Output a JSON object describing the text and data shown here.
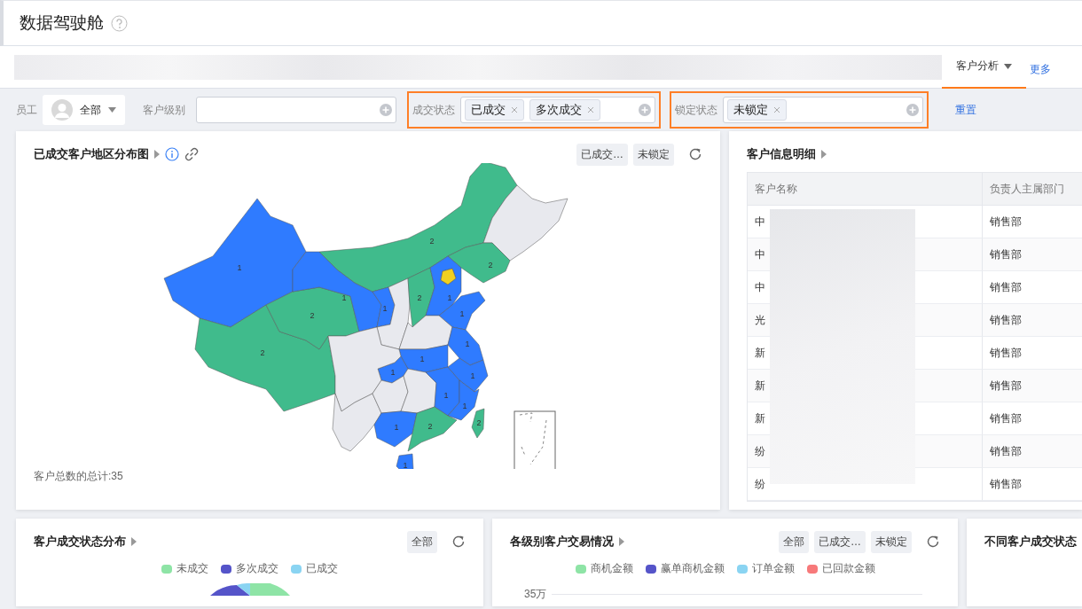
{
  "header": {
    "title": "数据驾驶舱"
  },
  "nav": {
    "tabs": [
      {
        "label": "客户分析",
        "selected": true
      }
    ],
    "more_link": "更多"
  },
  "filters": {
    "employee": {
      "label": "员工",
      "value": "全部"
    },
    "customer_level": {
      "label": "客户级别"
    },
    "deal_status": {
      "label": "成交状态",
      "highlighted": true,
      "tags": [
        "已成交",
        "多次成交"
      ]
    },
    "lock_status": {
      "label": "锁定状态",
      "highlighted": true,
      "tags": [
        "未锁定"
      ]
    },
    "reset": "重置"
  },
  "map_card": {
    "title": "已成交客户地区分布图",
    "chips": [
      "已成交…",
      "未锁定"
    ],
    "regions": [
      {
        "label": "1",
        "color": "#2f7bff"
      },
      {
        "label": "2",
        "color": "#40bb8c"
      },
      {
        "label": "2",
        "color": "#40bb8c"
      },
      {
        "label": "1",
        "color": "#2f7bff"
      },
      {
        "label": "2",
        "color": "#40bb8c"
      },
      {
        "color": "#e8e9ee"
      },
      {
        "label": "2",
        "color": "#40bb8c"
      },
      {
        "label": "1",
        "color": "#2f7bff"
      },
      {
        "color": "#e8e9ee"
      },
      {
        "label": "2",
        "color": "#40bb8c"
      },
      {
        "label": "1",
        "color": "#2f7bff"
      },
      {
        "color": "#f0d020"
      },
      {
        "label": "1",
        "color": "#2f7bff"
      },
      {
        "color": "#e8e9ee"
      },
      {
        "label": "1",
        "color": "#2f7bff"
      },
      {
        "label": "1",
        "color": "#2f7bff"
      },
      {
        "label": "1",
        "color": "#2f7bff"
      },
      {
        "color": "#e8e9ee"
      },
      {
        "color": "#e8e9ee"
      },
      {
        "color": "#e8e9ee"
      },
      {
        "color": "#e8e9ee"
      },
      {
        "label": "1",
        "color": "#2f7bff"
      },
      {
        "label": "1",
        "color": "#2f7bff"
      },
      {
        "label": "1",
        "color": "#2f7bff"
      },
      {
        "label": "1",
        "color": "#2f7bff"
      },
      {
        "label": "2",
        "color": "#40bb8c"
      },
      {
        "label": "1",
        "color": "#2f7bff"
      },
      {
        "label": "2",
        "color": "#40bb8c"
      }
    ],
    "footer": "客户总数的总计:35"
  },
  "table_card": {
    "title": "客户信息明细",
    "columns": [
      "客户名称",
      "负责人主属部门"
    ],
    "rows": [
      [
        "中",
        "销售部"
      ],
      [
        "中",
        "销售部"
      ],
      [
        "中",
        "销售部"
      ],
      [
        "光",
        "销售部"
      ],
      [
        "新",
        "销售部"
      ],
      [
        "新",
        "销售部"
      ],
      [
        "新",
        "销售部"
      ],
      [
        "纷",
        "销售部"
      ],
      [
        "纷",
        "销售部"
      ]
    ]
  },
  "bottom_cards": [
    {
      "kind": "pie",
      "title": "客户成交状态分布",
      "chips": [
        "全部"
      ],
      "legend": [
        {
          "label": "未成交",
          "color": "#8ee4a6"
        },
        {
          "label": "多次成交",
          "color": "#5554c9"
        },
        {
          "label": "已成交",
          "color": "#8ad4f2"
        }
      ]
    },
    {
      "kind": "bar",
      "title": "各级别客户交易情况",
      "chips": [
        "全部",
        "已成交…",
        "未锁定"
      ],
      "legend": [
        {
          "label": "商机金额",
          "color": "#8ee4a6"
        },
        {
          "label": "赢单商机金额",
          "color": "#5554c9"
        },
        {
          "label": "订单金额",
          "color": "#8ad4f2"
        },
        {
          "label": "已回款金额",
          "color": "#f7797a"
        }
      ],
      "y_tick": "35万"
    },
    {
      "kind": "empty",
      "title": "不同客户成交状态"
    }
  ]
}
